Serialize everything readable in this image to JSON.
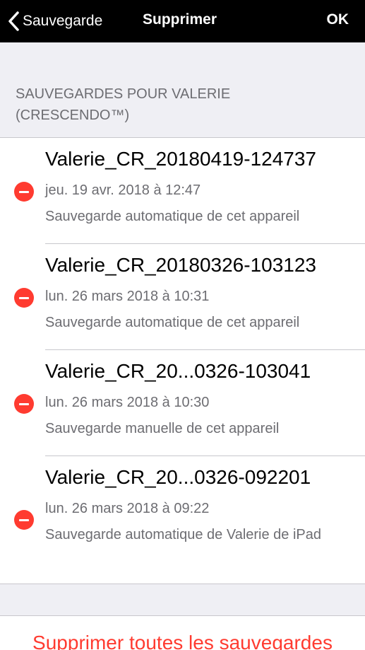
{
  "navbar": {
    "back_label": "Sauvegarde",
    "title": "Supprimer",
    "ok_label": "OK"
  },
  "section": {
    "header": "SAUVEGARDES POUR VALERIE (CRESCENDO™)"
  },
  "backups": [
    {
      "name": "Valerie_CR_20180419-124737",
      "date": "jeu. 19 avr. 2018 à 12:47",
      "description": "Sauvegarde automatique de cet appareil"
    },
    {
      "name": "Valerie_CR_20180326-103123",
      "date": "lun. 26 mars 2018 à 10:31",
      "description": "Sauvegarde automatique de cet appareil"
    },
    {
      "name": "Valerie_CR_20...0326-103041",
      "date": "lun. 26 mars 2018 à 10:30",
      "description": "Sauvegarde manuelle de cet appareil"
    },
    {
      "name": "Valerie_CR_20...0326-092201",
      "date": "lun. 26 mars 2018 à 09:22",
      "description": "Sauvegarde automatique de Valerie de iPad"
    }
  ],
  "actions": {
    "delete_all_label": "Supprimer toutes les sauvegardes"
  },
  "colors": {
    "destructive": "#ff3b30",
    "navbar_bg": "#000000",
    "background": "#efeff4"
  },
  "icons": {
    "back": "chevron-left-icon",
    "delete": "minus-circle-icon"
  }
}
